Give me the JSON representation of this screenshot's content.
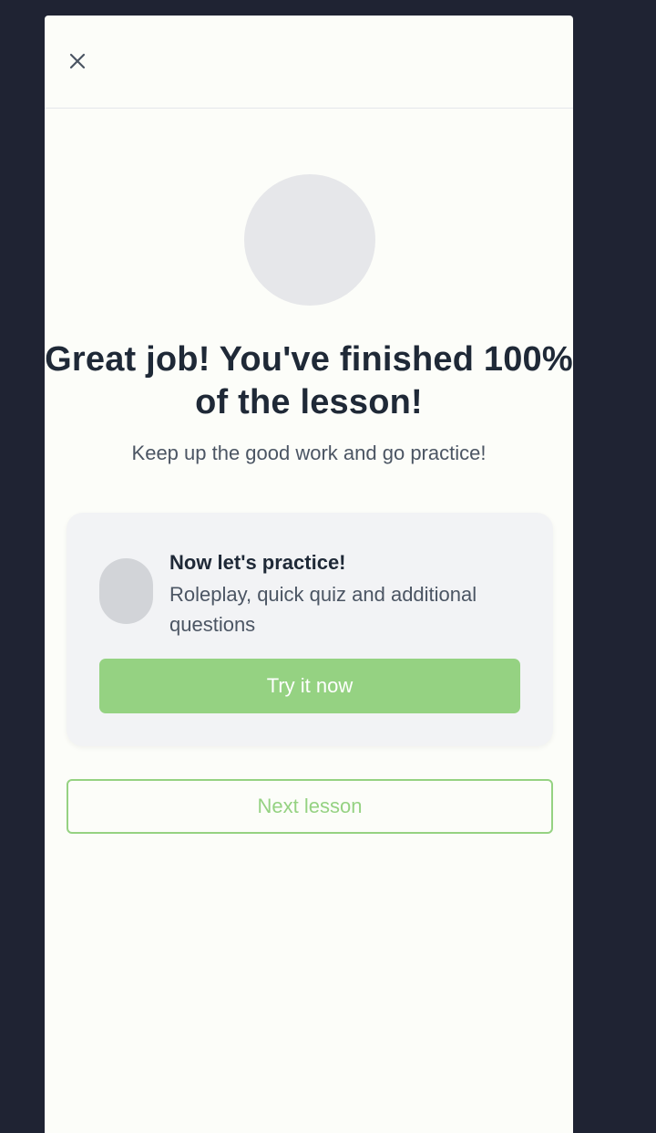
{
  "modal": {
    "close_icon": "close-icon",
    "title": "Great job! You've finished 100% of the lesson!",
    "subtitle": "Keep up the good work and go practice!",
    "practice": {
      "title": "Now let's practice!",
      "description": "Roleplay, quick quiz and additional questions",
      "button_label": "Try it now"
    },
    "next_button_label": "Next lesson"
  },
  "colors": {
    "backdrop": "#1f2333",
    "modal_bg": "#fcfdf9",
    "accent_green": "#95d282",
    "heading_text": "#1f2937",
    "body_text": "#4b5563",
    "card_bg": "#f2f3f5",
    "placeholder": "#e6e7ea"
  }
}
